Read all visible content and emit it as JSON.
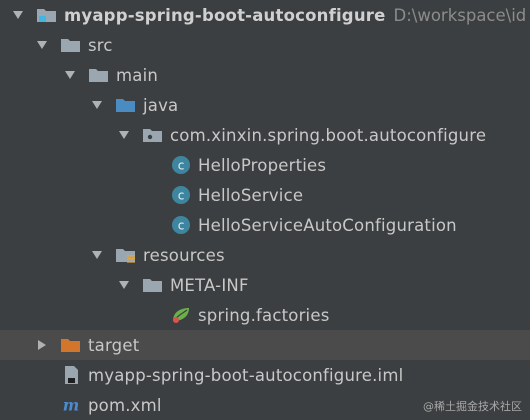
{
  "project": {
    "name": "myapp-spring-boot-autoconfigure",
    "path": "D:\\workspace\\id",
    "icon": "module-folder-icon"
  },
  "nodes": [
    {
      "label": "src",
      "icon": "folder-icon"
    },
    {
      "label": "main",
      "icon": "folder-icon"
    },
    {
      "label": "java",
      "icon": "source-folder-icon",
      "color": "#4a8cc2"
    },
    {
      "label": "com.xinxin.spring.boot.autoconfigure",
      "icon": "package-icon"
    },
    {
      "label": "HelloProperties",
      "icon": "class-icon",
      "color": "#3e86a0"
    },
    {
      "label": "HelloService",
      "icon": "class-icon",
      "color": "#3e86a0"
    },
    {
      "label": "HelloServiceAutoConfiguration",
      "icon": "class-icon",
      "color": "#3e86a0"
    },
    {
      "label": "resources",
      "icon": "resources-folder-icon"
    },
    {
      "label": "META-INF",
      "icon": "folder-icon"
    },
    {
      "label": "spring.factories",
      "icon": "spring-file-icon"
    },
    {
      "label": "target",
      "icon": "excluded-folder-icon",
      "color": "#d1762a"
    },
    {
      "label": "myapp-spring-boot-autoconfigure.iml",
      "icon": "iml-file-icon"
    },
    {
      "label": "pom.xml",
      "icon": "maven-icon",
      "color": "#4b8bd1"
    }
  ],
  "watermark": "@稀土掘金技术社区"
}
